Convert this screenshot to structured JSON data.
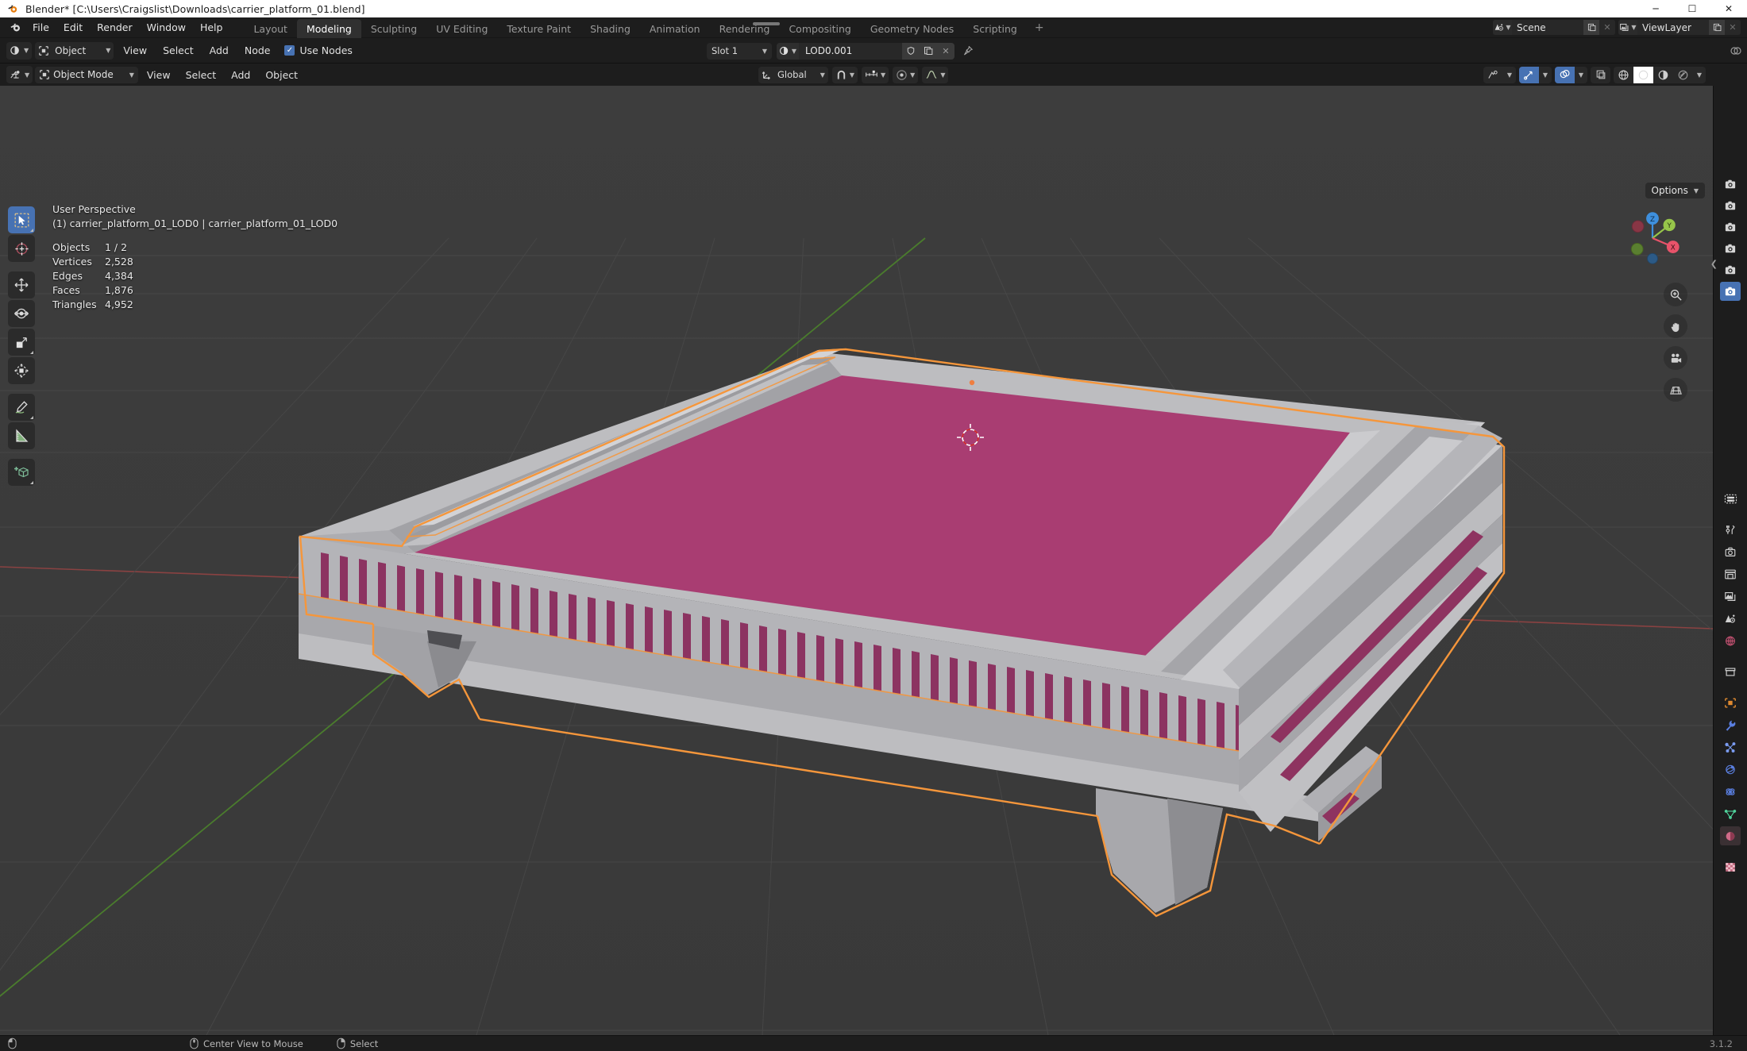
{
  "window": {
    "title": "Blender* [C:\\Users\\Craigslist\\Downloads\\carrier_platform_01.blend]",
    "app_icon": "blender-logo-icon",
    "minimize": "─",
    "maximize": "☐",
    "close": "✕"
  },
  "topbar": {
    "menus": [
      "File",
      "Edit",
      "Render",
      "Window",
      "Help"
    ],
    "workspaces": [
      {
        "label": "Layout",
        "active": false
      },
      {
        "label": "Modeling",
        "active": true
      },
      {
        "label": "Sculpting",
        "active": false
      },
      {
        "label": "UV Editing",
        "active": false
      },
      {
        "label": "Texture Paint",
        "active": false
      },
      {
        "label": "Shading",
        "active": false
      },
      {
        "label": "Animation",
        "active": false
      },
      {
        "label": "Rendering",
        "active": false
      },
      {
        "label": "Compositing",
        "active": false
      },
      {
        "label": "Geometry Nodes",
        "active": false
      },
      {
        "label": "Scripting",
        "active": false
      }
    ],
    "add_workspace": "+",
    "scene": {
      "icon": "scene-icon",
      "name": "Scene",
      "new_btn": "new-scene-icon",
      "unlink_btn": "✕"
    },
    "view_layer": {
      "icon": "view-layer-icon",
      "name": "ViewLayer",
      "new_btn": "new-layer-icon",
      "unlink_btn": "✕"
    }
  },
  "shader_editor": {
    "editor_type_icon": "shader-editor-icon",
    "shader_type": {
      "icon": "object-icon",
      "label": "Object"
    },
    "menus": [
      "View",
      "Select",
      "Add",
      "Node"
    ],
    "use_nodes": {
      "label": "Use Nodes",
      "checked": true
    },
    "slot": {
      "label": "Slot 1"
    },
    "material": {
      "icon": "material-icon",
      "name": "LOD0.001",
      "shield_btn": "fake-user-icon",
      "copy_btn": "new-material-icon",
      "unlink_btn": "✕",
      "pin_btn": "pin-icon"
    }
  },
  "viewport_header": {
    "editor_type_icon": "3d-viewport-icon",
    "mode": {
      "icon": "object-mode-icon",
      "label": "Object Mode"
    },
    "menus": [
      "View",
      "Select",
      "Add",
      "Object"
    ],
    "transform_orientation": {
      "icon": "orientation-icon",
      "label": "Global"
    },
    "snap": {
      "icon": "magnet-icon",
      "enabled": false
    },
    "snap_target": {
      "icon": "snap-increment-icon"
    },
    "proportional_edit": {
      "icon": "proportional-icon",
      "enabled": false
    },
    "falloff": {
      "icon": "falloff-curve-icon"
    },
    "visibility_icon": "visibility-icon",
    "gizmo_toggle": {
      "icon": "gizmo-icon",
      "enabled": true
    },
    "overlays_toggle": {
      "icon": "overlays-icon",
      "enabled": true
    },
    "xray_toggle": {
      "icon": "xray-icon",
      "enabled": false
    },
    "shading_modes": [
      {
        "icon": "wireframe-shading-icon",
        "active": false
      },
      {
        "icon": "solid-shading-icon",
        "active": true
      },
      {
        "icon": "material-preview-shading-icon",
        "active": false
      },
      {
        "icon": "rendered-shading-icon",
        "active": false
      }
    ]
  },
  "viewport": {
    "options_label": "Options",
    "perspective": "User Perspective",
    "object_info": "(1) carrier_platform_01_LOD0 | carrier_platform_01_LOD0",
    "stats": [
      {
        "key": "Objects",
        "value": "1 / 2"
      },
      {
        "key": "Vertices",
        "value": "2,528"
      },
      {
        "key": "Edges",
        "value": "4,384"
      },
      {
        "key": "Faces",
        "value": "1,876"
      },
      {
        "key": "Triangles",
        "value": "4,952"
      }
    ],
    "gizmo_axes": [
      {
        "label": "X",
        "color": "#e8536a",
        "filled": true
      },
      {
        "label": "Y",
        "color": "#97c64a",
        "filled": true
      },
      {
        "label": "Z",
        "color": "#3e8fdd",
        "filled": true
      },
      {
        "label": "",
        "color": "#883645",
        "filled": false
      },
      {
        "label": "",
        "color": "#5a7f30",
        "filled": false
      },
      {
        "label": "",
        "color": "#2c5a86",
        "filled": false
      }
    ],
    "nav_buttons": [
      {
        "icon": "zoom-icon"
      },
      {
        "icon": "hand-pan-icon"
      },
      {
        "icon": "camera-view-icon"
      },
      {
        "icon": "ortho-perspective-icon"
      }
    ],
    "model_colors": {
      "metal_light": "#c3c3c5",
      "metal_mid": "#a9a9ac",
      "metal_dark": "#8d8d90",
      "magenta": "#a93d72",
      "magenta_dark": "#8e3360",
      "selection_outline": "#f5963b"
    },
    "background": "#3b3b3b",
    "grid_color": "#4a4a4a",
    "axis_x_color": "#a33b3b",
    "axis_y_color": "#4f8a2e"
  },
  "toolbar": {
    "tools": [
      {
        "icon": "tweak-select-tool-icon",
        "active": true
      },
      {
        "icon": "cursor-tool-icon",
        "active": false
      },
      {
        "icon": "move-tool-icon",
        "active": false
      },
      {
        "icon": "rotate-tool-icon",
        "active": false
      },
      {
        "icon": "scale-tool-icon",
        "active": false
      },
      {
        "icon": "transform-tool-icon",
        "active": false
      },
      {
        "icon": "annotate-tool-icon",
        "active": false
      },
      {
        "icon": "measure-tool-icon",
        "active": false
      },
      {
        "icon": "add-cube-tool-icon",
        "active": false
      }
    ]
  },
  "properties_tabs": {
    "top_group": [
      {
        "icon": "tool-properties-icon",
        "active": false
      },
      {
        "icon": "render-properties-icon",
        "active": false
      },
      {
        "icon": "output-properties-icon",
        "active": false
      },
      {
        "icon": "view-layer-properties-icon",
        "active": false
      },
      {
        "icon": "scene-properties-icon",
        "active": false
      },
      {
        "icon": "world-properties-icon",
        "active": true
      }
    ],
    "bottom_group": [
      {
        "icon": "editor-type-icon",
        "active": false
      },
      {
        "icon": "tool-icon",
        "active": false
      },
      {
        "icon": "render-icon",
        "active": false
      },
      {
        "icon": "printer-output-icon",
        "active": false
      },
      {
        "icon": "view-layer-icon",
        "active": false
      },
      {
        "icon": "scene-icon",
        "active": false
      },
      {
        "icon": "world-icon",
        "active": false
      },
      {
        "icon": "collection-icon",
        "active": false
      },
      {
        "icon": "object-properties-icon",
        "active": false
      },
      {
        "icon": "modifier-wrench-icon",
        "active": false
      },
      {
        "icon": "particles-icon",
        "active": false
      },
      {
        "icon": "physics-icon",
        "active": false
      },
      {
        "icon": "constraints-icon",
        "active": false
      },
      {
        "icon": "object-data-icon",
        "active": false
      },
      {
        "icon": "material-properties-icon",
        "active": true
      },
      {
        "icon": "texture-properties-icon",
        "active": false
      }
    ]
  },
  "statusbar": {
    "items": [
      {
        "icon": "mouse-left-icon",
        "label": ""
      },
      {
        "icon": "mouse-middle-icon",
        "label": "Center View to Mouse"
      },
      {
        "icon": "mouse-right-icon",
        "label": "Select"
      }
    ],
    "version": "3.1.2"
  }
}
